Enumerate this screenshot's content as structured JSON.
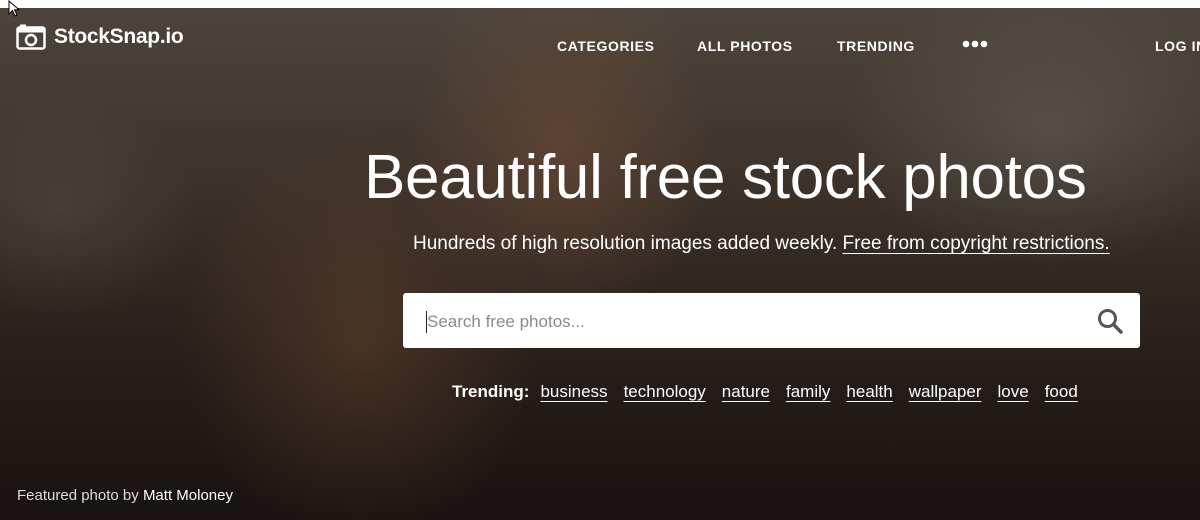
{
  "brand": {
    "name": "StockSnap.io",
    "logo_icon": "camera-icon"
  },
  "nav": {
    "items": [
      {
        "label": "CATEGORIES"
      },
      {
        "label": "ALL PHOTOS"
      },
      {
        "label": "TRENDING"
      }
    ],
    "more_icon": "more-dots-icon",
    "login_label": "LOG IN"
  },
  "hero": {
    "headline": "Beautiful free stock photos",
    "subline_text": "Hundreds of high resolution images added weekly.",
    "subline_link": "Free from copyright restrictions."
  },
  "search": {
    "placeholder": "Search free photos...",
    "value": "",
    "icon": "search-icon"
  },
  "trending": {
    "label": "Trending:",
    "tags": [
      "business",
      "technology",
      "nature",
      "family",
      "health",
      "wallpaper",
      "love",
      "food"
    ]
  },
  "credit": {
    "prefix": "Featured photo by",
    "author": "Matt Moloney"
  },
  "colors": {
    "hero_text": "#ffffff",
    "search_bg": "#ffffff",
    "topbar": "#ffffff"
  }
}
